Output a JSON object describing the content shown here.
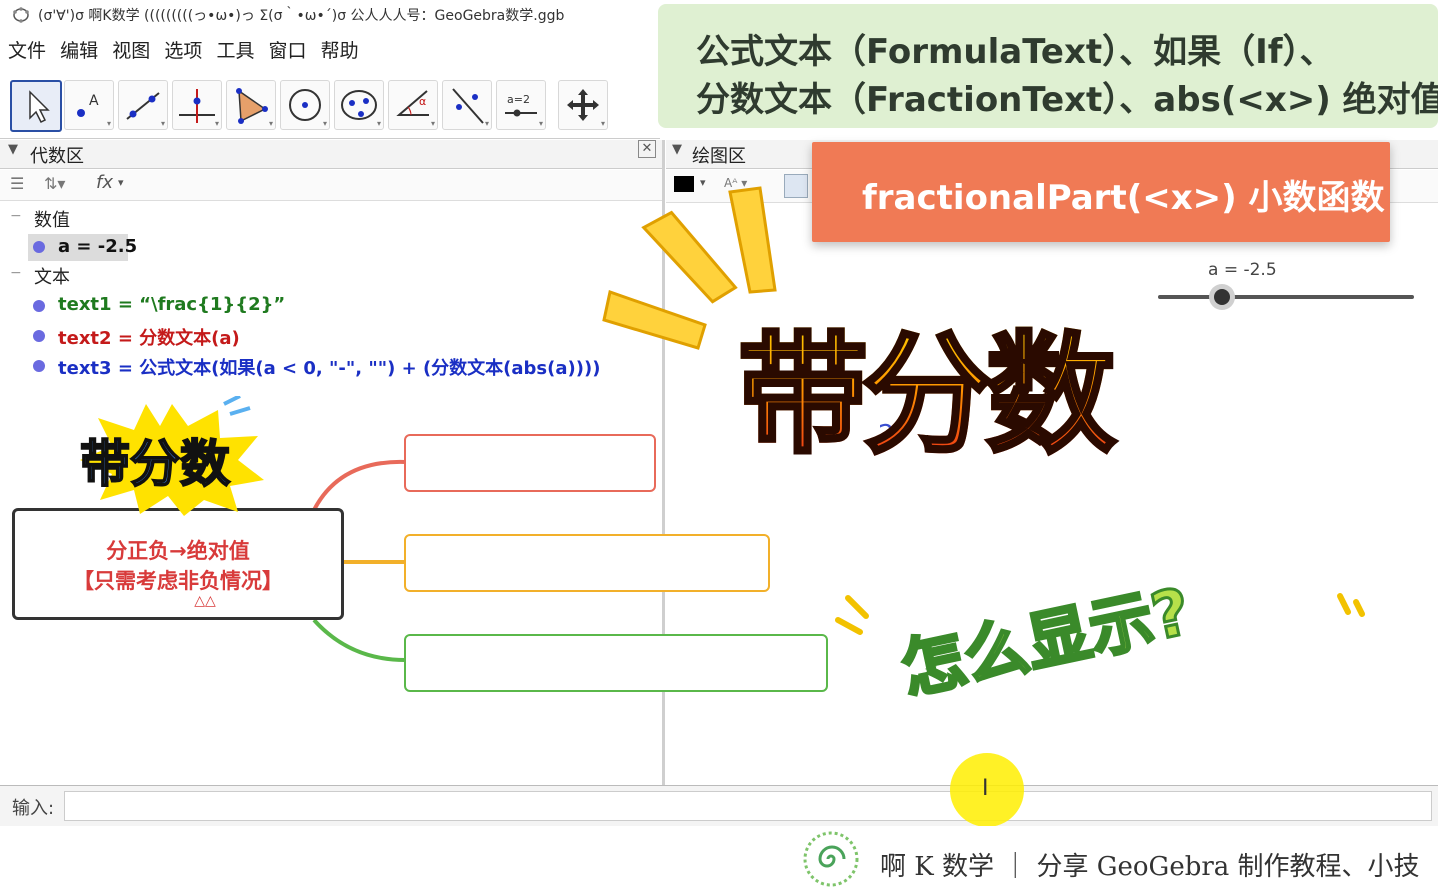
{
  "window": {
    "title": "(σ'∀')σ  啊K数学      (((((((((っ•ω•)っ Σ(σ｀•ω•´)σ  公人人人号：GeoGebra数学.ggb"
  },
  "menu": [
    "文件",
    "编辑",
    "视图",
    "选项",
    "工具",
    "窗口",
    "帮助"
  ],
  "algebra": {
    "header": "代数区",
    "groups": {
      "numbers": "数值",
      "text": "文本"
    },
    "a_item": "a = -2.5",
    "items": [
      {
        "label": "text1 = “\\frac{1}{2}”",
        "color": "#1f7a1f"
      },
      {
        "label": "text2 = 分数文本(a)",
        "color": "#c41a1a"
      },
      {
        "label": "text3 = 公式文本(如果(a < 0, \"-\", \"\") + (分数文本(abs(a))))",
        "color": "#1a2fc4"
      }
    ],
    "fx_label": "fx"
  },
  "graphics": {
    "header": "绘图区",
    "slider_label": "a = -2.5",
    "slider_value": -2.5,
    "partial_glyph": "2"
  },
  "toolbar": {
    "line_label": "a=2"
  },
  "input": {
    "label": "输入:",
    "value": ""
  },
  "footer": {
    "text": "啊 K 数学  ｜  分享 GeoGebra 制作教程、小技"
  },
  "overlay": {
    "banner_line1": "公式文本（FormulaText）、如果（If）、",
    "banner_line2": "分数文本（FractionText）、abs(<x>) 绝对值",
    "orange_banner": "fractionalPart(<x>) 小数函数",
    "big_title": "带分数",
    "question": "怎么显示?",
    "mind_title": "带分数",
    "mind_line1": "分正负→绝对值",
    "mind_line2": "【只需考虑非负情况】",
    "mind_marks": "△△"
  },
  "colors": {
    "accent_blue": "#2a4fa5",
    "green_banner": "#dff0d2",
    "orange_banner": "#f07a55",
    "dot": "#6a6ae0"
  }
}
